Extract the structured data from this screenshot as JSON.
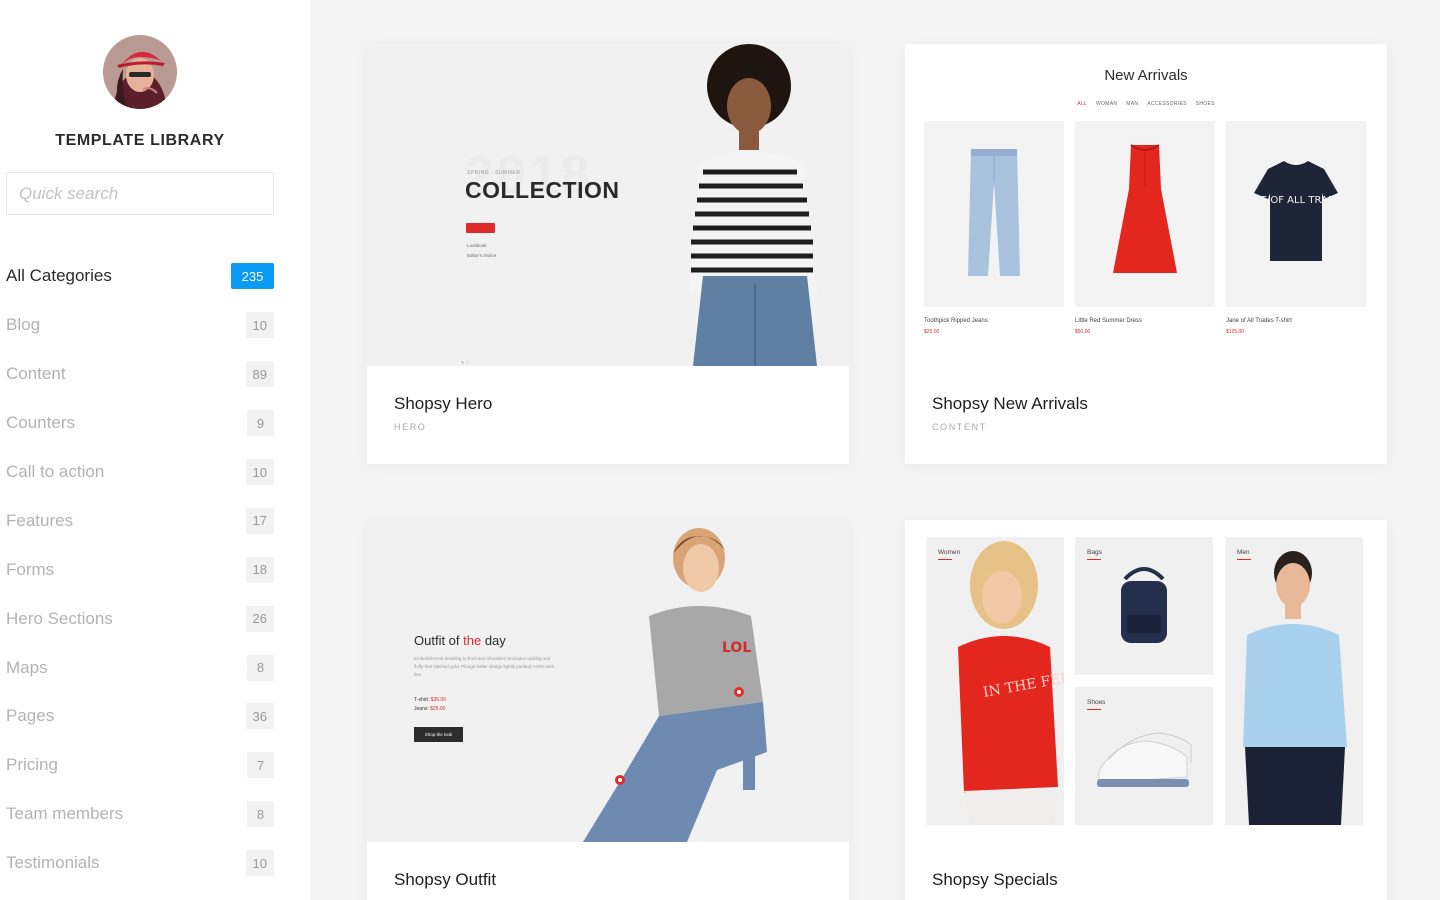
{
  "sidebar": {
    "title": "TEMPLATE LIBRARY",
    "search_placeholder": "Quick search",
    "categories": [
      {
        "name": "All Categories",
        "count": "235"
      },
      {
        "name": "Blog",
        "count": "10"
      },
      {
        "name": "Content",
        "count": "89"
      },
      {
        "name": "Counters",
        "count": "9"
      },
      {
        "name": "Call to action",
        "count": "10"
      },
      {
        "name": "Features",
        "count": "17"
      },
      {
        "name": "Forms",
        "count": "18"
      },
      {
        "name": "Hero Sections",
        "count": "26"
      },
      {
        "name": "Maps",
        "count": "8"
      },
      {
        "name": "Pages",
        "count": "36"
      },
      {
        "name": "Pricing",
        "count": "7"
      },
      {
        "name": "Team members",
        "count": "8"
      },
      {
        "name": "Testimonials",
        "count": "10"
      }
    ],
    "active_color": "#0a9bf5"
  },
  "cards": [
    {
      "title": "Shopsy Hero",
      "category": "HERO",
      "preview": {
        "year": "2018",
        "kicker": "SPRING - SUMMER",
        "headline": "COLLECTION",
        "links": [
          "Lookbook",
          "Editor's choice"
        ]
      }
    },
    {
      "title": "Shopsy New Arrivals",
      "category": "CONTENT",
      "preview": {
        "heading": "New Arrivals",
        "tabs": [
          "ALL",
          "WOMAN",
          "MAN",
          "ACCESSORIES",
          "SHOES"
        ],
        "products": [
          {
            "name": "Toothpick Ripped Jeans",
            "price": "$25.00"
          },
          {
            "name": "Little Red Summer Dress",
            "price": "$50.00"
          },
          {
            "name": "Jane of All Trades T-shirt",
            "price": "$125.00"
          }
        ],
        "shirt_text": "JANE OF ALL TRADES"
      }
    },
    {
      "title": "Shopsy Outfit",
      "category": "",
      "preview": {
        "heading_start": "Outfit of ",
        "heading_accent": "the",
        "heading_end": " day",
        "description": "Embellishment detailing to front and shoulders brocades quilting and fluffy-feel stitched gold. Plunge halter design lightly padded t-shirt neck line",
        "price_lines": [
          {
            "label": "T-shirt: ",
            "value": "$35.00"
          },
          {
            "label": "Jeans: ",
            "value": "$25.00"
          }
        ],
        "button": "Shop the look",
        "shirt_text": "LOL"
      }
    },
    {
      "title": "Shopsy Specials",
      "category": "",
      "preview": {
        "labels": [
          "Women",
          "Bags",
          "Shoes",
          "Men"
        ],
        "shirt_text": "IN THE FEELS"
      }
    }
  ],
  "colors": {
    "accent_red": "#e02b2b",
    "page_bg": "#f4f4f4"
  }
}
